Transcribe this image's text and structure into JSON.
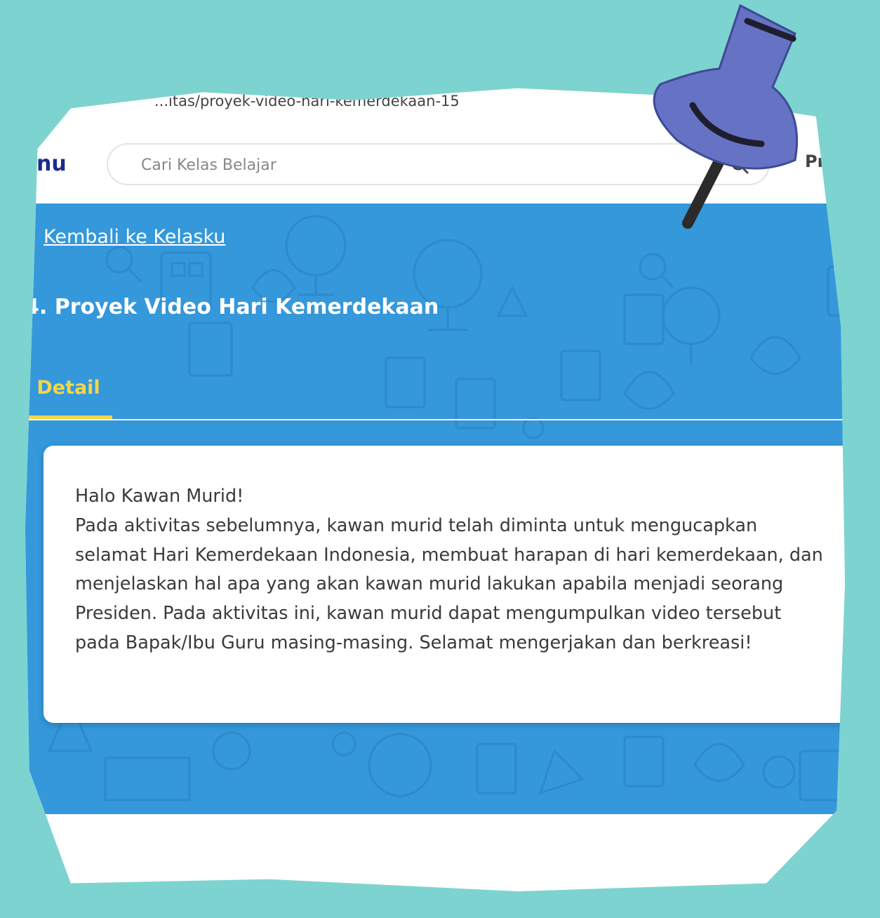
{
  "browser": {
    "url": "...itas/proyek-video-hari-kemerdekaan-15"
  },
  "header": {
    "logo_text": "nu",
    "search_placeholder": "Cari Kelas Belajar",
    "right_label": "Pr"
  },
  "hero": {
    "back_label": "Kembali ke Kelasku",
    "title": "4. Proyek Video Hari Kemerdekaan",
    "tabs": [
      {
        "label": "Detail",
        "active": true
      }
    ]
  },
  "card": {
    "greeting": "Halo Kawan Murid!",
    "body": "Pada aktivitas sebelumnya, kawan murid telah diminta untuk mengucapkan selamat Hari Kemerdekaan Indonesia, membuat harapan di hari kemerdekaan, dan menjelaskan hal apa yang akan kawan murid lakukan apabila menjadi seorang Presiden. Pada aktivitas ini, kawan murid dapat mengumpulkan video tersebut pada Bapak/Ibu Guru masing-masing. Selamat mengerjakan dan berkreasi!"
  },
  "colors": {
    "page_bg": "#7dd3cf",
    "hero_blue": "#3498db",
    "tab_active": "#f5d547",
    "pin": "#6673c4",
    "logo": "#1b2b8f"
  },
  "icons": [
    "search-icon",
    "chevron-left-icon",
    "pushpin-icon"
  ]
}
